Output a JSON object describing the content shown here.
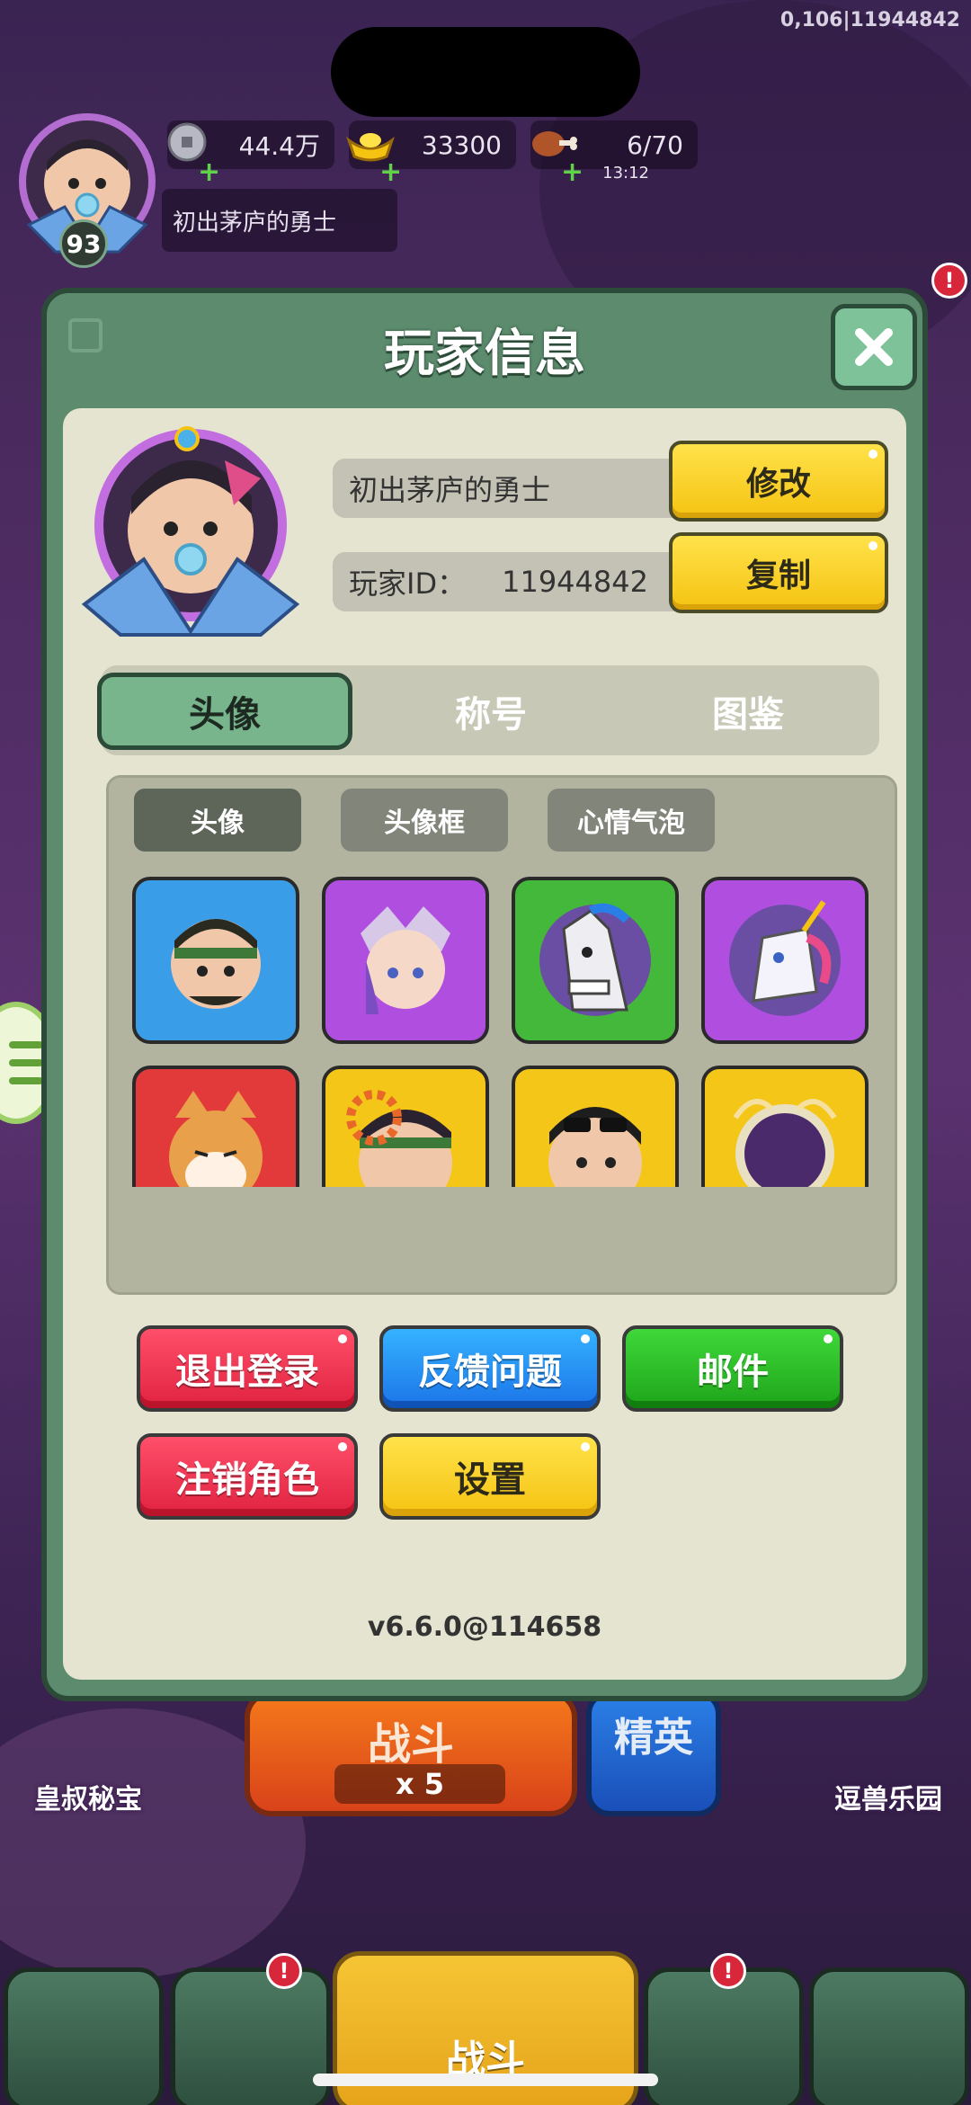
{
  "status": {
    "top_right_text": "0,106|11944842"
  },
  "hud": {
    "level": "93",
    "player_name": "初出茅庐的勇士",
    "resources": [
      {
        "icon": "coin-icon",
        "value": "44.4万"
      },
      {
        "icon": "gold-ingot-icon",
        "value": "33300"
      },
      {
        "icon": "meat-icon",
        "value": "6/70",
        "sub": "13:12"
      }
    ]
  },
  "alerts": {
    "badge": "!"
  },
  "bottom": {
    "left_label": "皇叔秘宝",
    "right_label": "逗兽乐园",
    "battle_label": "战斗",
    "battle_count": "x 5",
    "elite_label": "精英",
    "nav_center_label": "战斗"
  },
  "modal": {
    "title": "玩家信息",
    "name_value": "初出茅庐的勇士",
    "id_label": "玩家ID：",
    "id_value": "11944842",
    "edit_button": "修改",
    "copy_button": "复制",
    "tabs": [
      "头像",
      "称号",
      "图鉴"
    ],
    "subtabs": [
      "头像",
      "头像框",
      "心情气泡"
    ],
    "avatar_icons": [
      {
        "icon": "warrior-avatar-icon",
        "color": "#3a9de8"
      },
      {
        "icon": "fox-lady-avatar-icon",
        "color": "#b04ee0"
      },
      {
        "icon": "horse-avatar-icon",
        "color": "#44b83a"
      },
      {
        "icon": "unicorn-avatar-icon",
        "color": "#b04ee0"
      },
      {
        "icon": "shiba-avatar-icon",
        "color": "#e23a3a"
      },
      {
        "icon": "headband-avatar-icon",
        "color": "#f4c618"
      },
      {
        "icon": "sunglasses-avatar-icon",
        "color": "#f4c618"
      },
      {
        "icon": "golden-frame-avatar-icon",
        "color": "#f4c618"
      }
    ],
    "actions": {
      "logout": "退出登录",
      "feedback": "反馈问题",
      "mail": "邮件",
      "delete_character": "注销角色",
      "settings": "设置"
    },
    "version": "v6.6.0@114658"
  }
}
